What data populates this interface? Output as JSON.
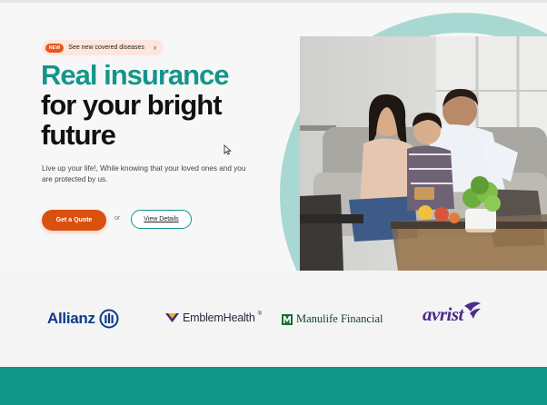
{
  "announcement": {
    "badge": "NEW",
    "text": "See new covered diseases",
    "chevron": "›"
  },
  "hero": {
    "headline_line1": "Real insurance",
    "headline_line2": "for your bright",
    "headline_line3": "future",
    "subtext": "Live up your life!, While knowing that your loved ones and you are protected by us.",
    "primary_cta": "Get a Quote",
    "or_text": "or",
    "secondary_cta": "View Details",
    "image_icon": "family-photo"
  },
  "partners": {
    "allianz": "Allianz",
    "emblem": "EmblemHealth",
    "emblem_mark": "®",
    "manulife": "Manulife Financial",
    "avrist": "avrist"
  },
  "colors": {
    "brand_teal": "#13968a",
    "accent_orange": "#d9500f",
    "arc_teal": "#a9d8d2",
    "heading_dark": "#111111"
  }
}
